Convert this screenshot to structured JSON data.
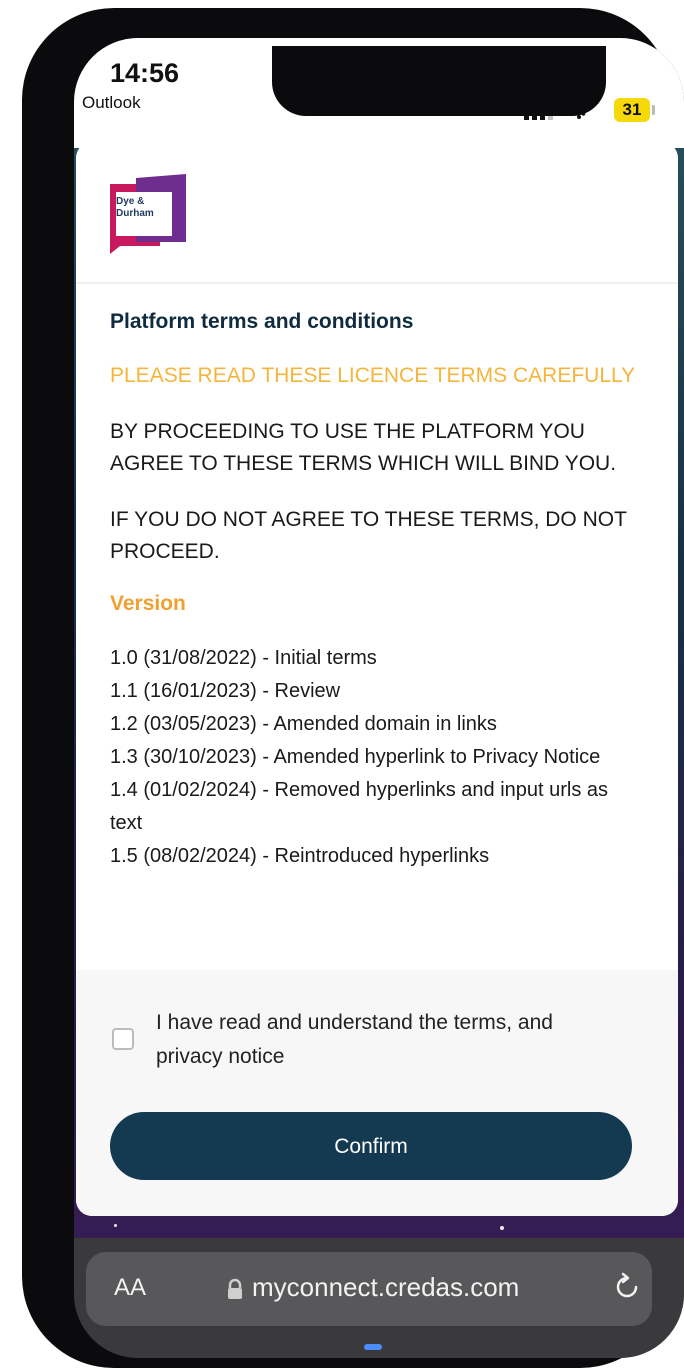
{
  "status_bar": {
    "time": "14:56",
    "back_app": "Outlook",
    "battery": "31"
  },
  "brand": {
    "logo_line1": "Dye &",
    "logo_line2": "Durham",
    "colors": {
      "magenta": "#c8195f",
      "purple": "#6f2d8f",
      "navy": "#143a52",
      "warning": "#f5b53d",
      "version_heading": "#f0a030"
    }
  },
  "terms": {
    "title": "Platform terms and conditions",
    "warning": "PLEASE READ THESE LICENCE TERMS CAREFULLY",
    "para_bind": "BY PROCEEDING TO USE THE PLATFORM YOU AGREE TO THESE TERMS WHICH WILL BIND YOU.",
    "para_disagree": "IF YOU DO NOT AGREE TO THESE TERMS, DO NOT PROCEED.",
    "version_heading": "Version",
    "versions": [
      "1.0 (31/08/2022) - Initial terms",
      "1.1 (16/01/2023) - Review",
      "1.2 (03/05/2023) - Amended domain in links",
      "1.3 (30/10/2023) - Amended hyperlink to Privacy Notice",
      "1.4 (01/02/2024) - Removed hyperlinks and input urls as text",
      "1.5 (08/02/2024) - Reintroduced hyperlinks"
    ]
  },
  "agreement": {
    "checkbox_label": "I have read and understand the terms, and privacy notice",
    "checked": false,
    "confirm_label": "Confirm"
  },
  "browser": {
    "text_size_label": "AA",
    "url": "myconnect.credas.com"
  },
  "icons": [
    "signal-icon",
    "wifi-icon",
    "battery-icon",
    "lock-icon",
    "reload-icon"
  ]
}
